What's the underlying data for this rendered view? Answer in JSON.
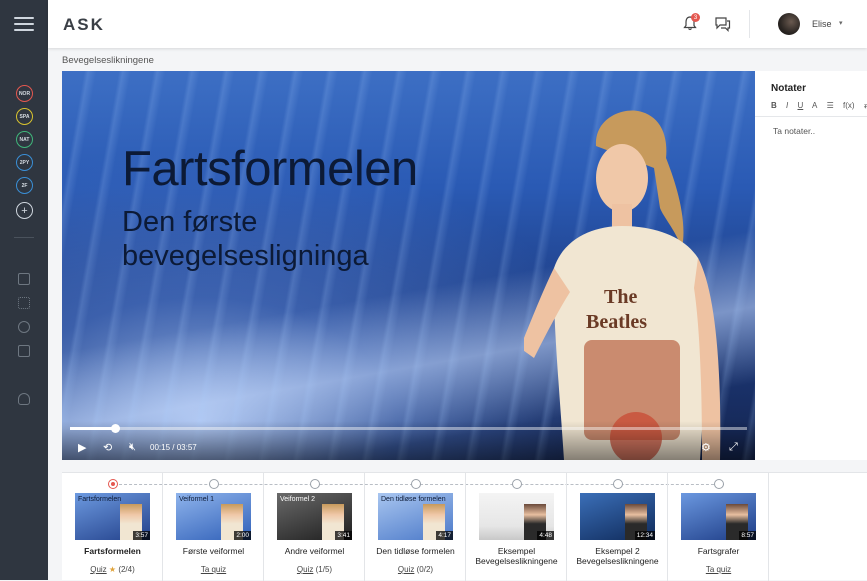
{
  "app": {
    "logo": "ASK"
  },
  "sidebar": {
    "subjects": [
      {
        "code": "NOR",
        "color": "#e4574f"
      },
      {
        "code": "SPA",
        "color": "#d7c22f"
      },
      {
        "code": "NAT",
        "color": "#3fb67a"
      },
      {
        "code": "2PY",
        "color": "#3a8fd6"
      },
      {
        "code": "2F",
        "color": "#3a8fd6"
      }
    ]
  },
  "header": {
    "notifications_count": "3",
    "user_name": "Elise"
  },
  "breadcrumb": "Bevegelseslikningene",
  "video": {
    "title": "Fartsformelen",
    "subtitle_line1": "Den første",
    "subtitle_line2": "bevegelsesligninga",
    "current_time": "00:15",
    "duration": "03:57",
    "progress": 0.066
  },
  "notes": {
    "title": "Notater",
    "toolbar": [
      "B",
      "I",
      "U",
      "A",
      "☰",
      "f(x)",
      "⇄"
    ],
    "placeholder": "Ta notater.."
  },
  "lessons": [
    {
      "title": "Fartsformelen",
      "thumb_text": "Fartsformelen",
      "duration": "3:57",
      "link": "Quiz",
      "extra": "(2/4)",
      "active": true,
      "star": true
    },
    {
      "title": "Første veiformel",
      "thumb_text": "Veiformel 1",
      "duration": "2:00",
      "link": "Ta quiz",
      "extra": "",
      "active": false,
      "star": false
    },
    {
      "title": "Andre veiformel",
      "thumb_text": "Veiformel 2",
      "duration": "3:41",
      "link": "Quiz",
      "extra": "(1/5)",
      "active": false,
      "star": false
    },
    {
      "title": "Den tidløse formelen",
      "thumb_text": "Den tidløse formelen",
      "duration": "4:17",
      "link": "Quiz",
      "extra": "(0/2)",
      "active": false,
      "star": false
    },
    {
      "title": "Eksempel Bevegelseslikningene",
      "thumb_text": "",
      "duration": "4:48",
      "link": "",
      "extra": "",
      "active": false,
      "star": false
    },
    {
      "title": "Eksempel 2 Bevegelseslikningene",
      "thumb_text": "",
      "duration": "12:34",
      "link": "",
      "extra": "",
      "active": false,
      "star": false
    },
    {
      "title": "Fartsgrafer",
      "thumb_text": "",
      "duration": "8:57",
      "link": "Ta quiz",
      "extra": "",
      "active": false,
      "star": false
    }
  ]
}
